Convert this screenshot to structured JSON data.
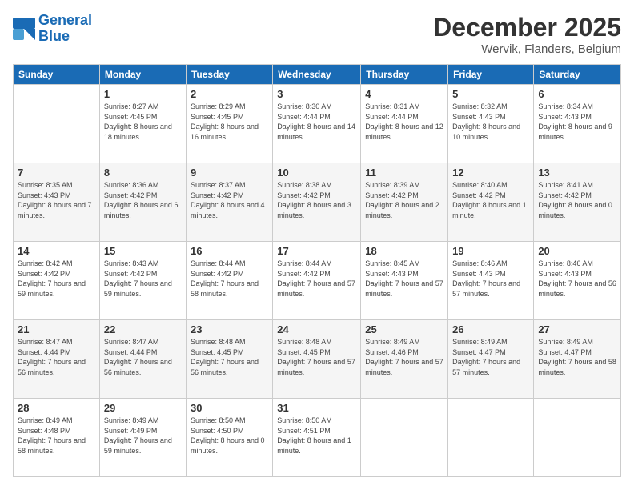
{
  "logo": {
    "line1": "General",
    "line2": "Blue"
  },
  "header": {
    "month": "December 2025",
    "location": "Wervik, Flanders, Belgium"
  },
  "weekdays": [
    "Sunday",
    "Monday",
    "Tuesday",
    "Wednesday",
    "Thursday",
    "Friday",
    "Saturday"
  ],
  "weeks": [
    [
      {
        "day": "",
        "sunrise": "",
        "sunset": "",
        "daylight": ""
      },
      {
        "day": "1",
        "sunrise": "Sunrise: 8:27 AM",
        "sunset": "Sunset: 4:45 PM",
        "daylight": "Daylight: 8 hours and 18 minutes."
      },
      {
        "day": "2",
        "sunrise": "Sunrise: 8:29 AM",
        "sunset": "Sunset: 4:45 PM",
        "daylight": "Daylight: 8 hours and 16 minutes."
      },
      {
        "day": "3",
        "sunrise": "Sunrise: 8:30 AM",
        "sunset": "Sunset: 4:44 PM",
        "daylight": "Daylight: 8 hours and 14 minutes."
      },
      {
        "day": "4",
        "sunrise": "Sunrise: 8:31 AM",
        "sunset": "Sunset: 4:44 PM",
        "daylight": "Daylight: 8 hours and 12 minutes."
      },
      {
        "day": "5",
        "sunrise": "Sunrise: 8:32 AM",
        "sunset": "Sunset: 4:43 PM",
        "daylight": "Daylight: 8 hours and 10 minutes."
      },
      {
        "day": "6",
        "sunrise": "Sunrise: 8:34 AM",
        "sunset": "Sunset: 4:43 PM",
        "daylight": "Daylight: 8 hours and 9 minutes."
      }
    ],
    [
      {
        "day": "7",
        "sunrise": "Sunrise: 8:35 AM",
        "sunset": "Sunset: 4:43 PM",
        "daylight": "Daylight: 8 hours and 7 minutes."
      },
      {
        "day": "8",
        "sunrise": "Sunrise: 8:36 AM",
        "sunset": "Sunset: 4:42 PM",
        "daylight": "Daylight: 8 hours and 6 minutes."
      },
      {
        "day": "9",
        "sunrise": "Sunrise: 8:37 AM",
        "sunset": "Sunset: 4:42 PM",
        "daylight": "Daylight: 8 hours and 4 minutes."
      },
      {
        "day": "10",
        "sunrise": "Sunrise: 8:38 AM",
        "sunset": "Sunset: 4:42 PM",
        "daylight": "Daylight: 8 hours and 3 minutes."
      },
      {
        "day": "11",
        "sunrise": "Sunrise: 8:39 AM",
        "sunset": "Sunset: 4:42 PM",
        "daylight": "Daylight: 8 hours and 2 minutes."
      },
      {
        "day": "12",
        "sunrise": "Sunrise: 8:40 AM",
        "sunset": "Sunset: 4:42 PM",
        "daylight": "Daylight: 8 hours and 1 minute."
      },
      {
        "day": "13",
        "sunrise": "Sunrise: 8:41 AM",
        "sunset": "Sunset: 4:42 PM",
        "daylight": "Daylight: 8 hours and 0 minutes."
      }
    ],
    [
      {
        "day": "14",
        "sunrise": "Sunrise: 8:42 AM",
        "sunset": "Sunset: 4:42 PM",
        "daylight": "Daylight: 7 hours and 59 minutes."
      },
      {
        "day": "15",
        "sunrise": "Sunrise: 8:43 AM",
        "sunset": "Sunset: 4:42 PM",
        "daylight": "Daylight: 7 hours and 59 minutes."
      },
      {
        "day": "16",
        "sunrise": "Sunrise: 8:44 AM",
        "sunset": "Sunset: 4:42 PM",
        "daylight": "Daylight: 7 hours and 58 minutes."
      },
      {
        "day": "17",
        "sunrise": "Sunrise: 8:44 AM",
        "sunset": "Sunset: 4:42 PM",
        "daylight": "Daylight: 7 hours and 57 minutes."
      },
      {
        "day": "18",
        "sunrise": "Sunrise: 8:45 AM",
        "sunset": "Sunset: 4:43 PM",
        "daylight": "Daylight: 7 hours and 57 minutes."
      },
      {
        "day": "19",
        "sunrise": "Sunrise: 8:46 AM",
        "sunset": "Sunset: 4:43 PM",
        "daylight": "Daylight: 7 hours and 57 minutes."
      },
      {
        "day": "20",
        "sunrise": "Sunrise: 8:46 AM",
        "sunset": "Sunset: 4:43 PM",
        "daylight": "Daylight: 7 hours and 56 minutes."
      }
    ],
    [
      {
        "day": "21",
        "sunrise": "Sunrise: 8:47 AM",
        "sunset": "Sunset: 4:44 PM",
        "daylight": "Daylight: 7 hours and 56 minutes."
      },
      {
        "day": "22",
        "sunrise": "Sunrise: 8:47 AM",
        "sunset": "Sunset: 4:44 PM",
        "daylight": "Daylight: 7 hours and 56 minutes."
      },
      {
        "day": "23",
        "sunrise": "Sunrise: 8:48 AM",
        "sunset": "Sunset: 4:45 PM",
        "daylight": "Daylight: 7 hours and 56 minutes."
      },
      {
        "day": "24",
        "sunrise": "Sunrise: 8:48 AM",
        "sunset": "Sunset: 4:45 PM",
        "daylight": "Daylight: 7 hours and 57 minutes."
      },
      {
        "day": "25",
        "sunrise": "Sunrise: 8:49 AM",
        "sunset": "Sunset: 4:46 PM",
        "daylight": "Daylight: 7 hours and 57 minutes."
      },
      {
        "day": "26",
        "sunrise": "Sunrise: 8:49 AM",
        "sunset": "Sunset: 4:47 PM",
        "daylight": "Daylight: 7 hours and 57 minutes."
      },
      {
        "day": "27",
        "sunrise": "Sunrise: 8:49 AM",
        "sunset": "Sunset: 4:47 PM",
        "daylight": "Daylight: 7 hours and 58 minutes."
      }
    ],
    [
      {
        "day": "28",
        "sunrise": "Sunrise: 8:49 AM",
        "sunset": "Sunset: 4:48 PM",
        "daylight": "Daylight: 7 hours and 58 minutes."
      },
      {
        "day": "29",
        "sunrise": "Sunrise: 8:49 AM",
        "sunset": "Sunset: 4:49 PM",
        "daylight": "Daylight: 7 hours and 59 minutes."
      },
      {
        "day": "30",
        "sunrise": "Sunrise: 8:50 AM",
        "sunset": "Sunset: 4:50 PM",
        "daylight": "Daylight: 8 hours and 0 minutes."
      },
      {
        "day": "31",
        "sunrise": "Sunrise: 8:50 AM",
        "sunset": "Sunset: 4:51 PM",
        "daylight": "Daylight: 8 hours and 1 minute."
      },
      {
        "day": "",
        "sunrise": "",
        "sunset": "",
        "daylight": ""
      },
      {
        "day": "",
        "sunrise": "",
        "sunset": "",
        "daylight": ""
      },
      {
        "day": "",
        "sunrise": "",
        "sunset": "",
        "daylight": ""
      }
    ]
  ]
}
